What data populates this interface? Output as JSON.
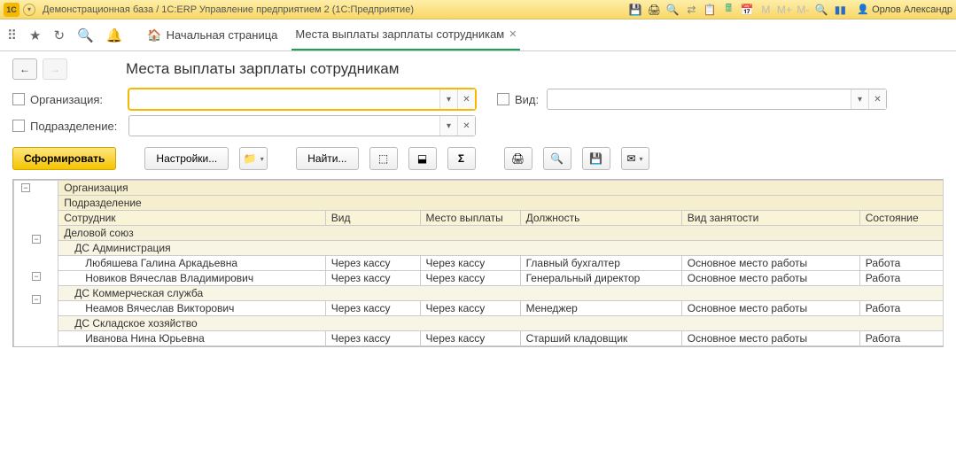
{
  "titlebar": {
    "app_title": "Демонстрационная база / 1С:ERP Управление предприятием 2  (1С:Предприятие)",
    "user": "Орлов Александр",
    "m_labels": [
      "M",
      "M+",
      "M-"
    ]
  },
  "tabs": {
    "home": "Начальная страница",
    "active": "Места выплаты зарплаты сотрудникам"
  },
  "page": {
    "title": "Места выплаты зарплаты сотрудникам"
  },
  "filters": {
    "org_label": "Организация:",
    "sub_label": "Подразделение:",
    "vid_label": "Вид:",
    "org_value": "",
    "sub_value": "",
    "vid_value": ""
  },
  "actions": {
    "form": "Сформировать",
    "settings": "Настройки...",
    "find": "Найти..."
  },
  "grid": {
    "headers": {
      "org": "Организация",
      "sub": "Подразделение",
      "emp": "Сотрудник",
      "vid": "Вид",
      "place": "Место выплаты",
      "position": "Должность",
      "emptype": "Вид занятости",
      "state": "Состояние"
    },
    "g0": {
      "name": "Деловой союз"
    },
    "g1a": {
      "name": "ДС Администрация",
      "rows": [
        {
          "emp": "Любяшева Галина Аркадьевна",
          "vid": "Через кассу",
          "place": "Через кассу",
          "pos": "Главный бухгалтер",
          "et": "Основное место работы",
          "st": "Работа"
        },
        {
          "emp": "Новиков Вячеслав Владимирович",
          "vid": "Через кассу",
          "place": "Через кассу",
          "pos": "Генеральный директор",
          "et": "Основное место работы",
          "st": "Работа"
        }
      ]
    },
    "g1b": {
      "name": "ДС Коммерческая служба",
      "rows": [
        {
          "emp": "Неамов Вячеслав Викторович",
          "vid": "Через кассу",
          "place": "Через кассу",
          "pos": "Менеджер",
          "et": "Основное место работы",
          "st": "Работа"
        }
      ]
    },
    "g1c": {
      "name": "ДС Складское хозяйство",
      "rows": [
        {
          "emp": "Иванова Нина Юрьевна",
          "vid": "Через кассу",
          "place": "Через кассу",
          "pos": "Старший кладовщик",
          "et": "Основное место работы",
          "st": "Работа"
        }
      ]
    }
  }
}
